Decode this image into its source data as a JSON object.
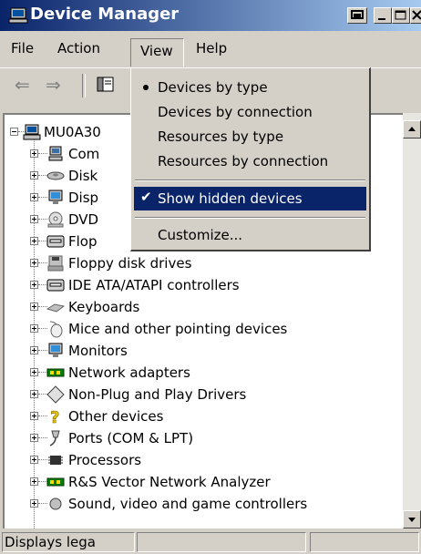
{
  "window": {
    "title": "Device Manager"
  },
  "menubar": {
    "file": "File",
    "action": "Action",
    "view": "View",
    "help": "Help"
  },
  "view_menu": {
    "items": [
      {
        "label": "Devices by type",
        "mark": "bullet"
      },
      {
        "label": "Devices by connection"
      },
      {
        "label": "Resources by type"
      },
      {
        "label": "Resources by connection"
      },
      {
        "label": "Show hidden devices",
        "mark": "check",
        "highlighted": true
      },
      {
        "label": "Customize..."
      }
    ]
  },
  "tree": {
    "root": "MU0A30",
    "items": [
      {
        "label": "Com",
        "icon": "computer-icon"
      },
      {
        "label": "Disk",
        "icon": "disk-drive-icon"
      },
      {
        "label": "Disp",
        "icon": "display-adapter-icon"
      },
      {
        "label": "DVD",
        "icon": "dvd-drive-icon"
      },
      {
        "label": "Flop",
        "icon": "floppy-controller-icon"
      },
      {
        "label": "Floppy disk drives",
        "icon": "floppy-drive-icon"
      },
      {
        "label": "IDE ATA/ATAPI controllers",
        "icon": "ide-controller-icon"
      },
      {
        "label": "Keyboards",
        "icon": "keyboard-icon"
      },
      {
        "label": "Mice and other pointing devices",
        "icon": "mouse-icon"
      },
      {
        "label": "Monitors",
        "icon": "monitor-icon"
      },
      {
        "label": "Network adapters",
        "icon": "network-adapter-icon"
      },
      {
        "label": "Non-Plug and Play Drivers",
        "icon": "non-pnp-driver-icon"
      },
      {
        "label": "Other devices",
        "icon": "other-devices-icon"
      },
      {
        "label": "Ports (COM & LPT)",
        "icon": "port-icon"
      },
      {
        "label": "Processors",
        "icon": "processor-icon"
      },
      {
        "label": "R&S Vector Network Analyzer",
        "icon": "network-analyzer-icon"
      },
      {
        "label": "Sound, video and game controllers",
        "icon": "sound-icon"
      }
    ]
  },
  "status": {
    "text": "Displays lega"
  },
  "colors": {
    "titlebar_start": "#0a246a",
    "titlebar_end": "#a6caf0",
    "highlight": "#0a246a",
    "chrome": "#d4d0c8"
  }
}
